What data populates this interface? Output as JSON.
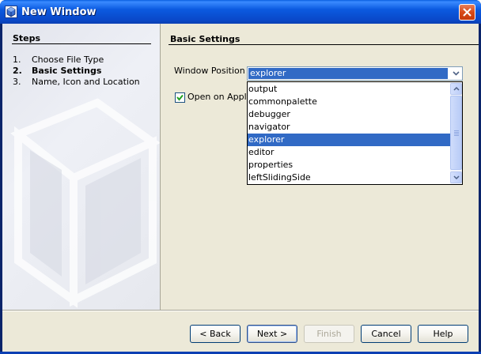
{
  "window": {
    "title": "New Window"
  },
  "steps": {
    "title": "Steps",
    "items": [
      {
        "num": "1.",
        "label": "Choose File Type",
        "active": false
      },
      {
        "num": "2.",
        "label": "Basic Settings",
        "active": true
      },
      {
        "num": "3.",
        "label": "Name, Icon and Location",
        "active": false
      }
    ]
  },
  "basic": {
    "title": "Basic Settings",
    "window_position_label": "Window Position :",
    "window_position_value": "explorer",
    "open_on_startup_label": "Open on Applica",
    "open_on_startup_checked": true,
    "options": [
      "output",
      "commonpalette",
      "debugger",
      "navigator",
      "explorer",
      "editor",
      "properties",
      "leftSlidingSide"
    ],
    "selected_option": "explorer"
  },
  "buttons": {
    "back": "< Back",
    "next": "Next >",
    "finish": "Finish",
    "cancel": "Cancel",
    "help": "Help"
  },
  "icons": {
    "app": "netbeans-cube-icon",
    "close": "close-icon",
    "combo_arrow": "chevron-down-icon",
    "scroll_up": "scroll-up-arrow-icon",
    "scroll_down": "scroll-down-arrow-icon",
    "checkbox": "checkmark-icon"
  },
  "colors": {
    "title_bar": "#0a5fe0",
    "selection": "#316ac5",
    "dialog_bg": "#ece9d8",
    "close_button": "#d84a18"
  }
}
